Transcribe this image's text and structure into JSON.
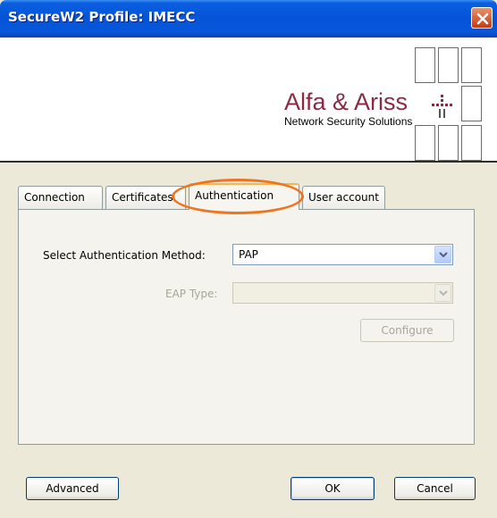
{
  "window": {
    "title": "SecureW2 Profile: IMECC"
  },
  "banner": {
    "logo_text": "Alfa & Ariss",
    "logo_tagline": "Network Security Solutions"
  },
  "tabs": [
    {
      "label": "Connection",
      "active": false
    },
    {
      "label": "Certificates",
      "active": false
    },
    {
      "label": "Authentication",
      "active": true
    },
    {
      "label": "User account",
      "active": false
    }
  ],
  "auth": {
    "method_label": "Select Authentication Method:",
    "method_value": "PAP",
    "eap_label": "EAP Type:",
    "eap_value": "",
    "configure_label": "Configure"
  },
  "footer": {
    "advanced_label": "Advanced",
    "ok_label": "OK",
    "cancel_label": "Cancel"
  },
  "colors": {
    "title_bar": "#0553D6",
    "logo": "#8A2B45",
    "annotation": "#EE7520"
  },
  "icons": [
    "close-icon",
    "chevron-down-icon",
    "logo-dots-icon"
  ]
}
